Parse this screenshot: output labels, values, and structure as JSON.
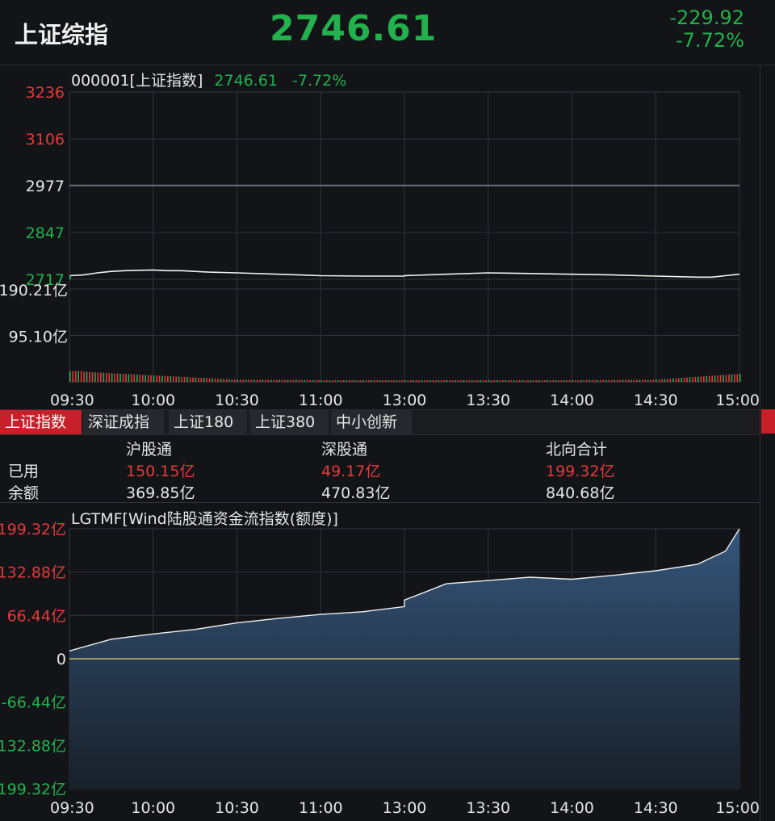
{
  "header": {
    "name": "上证综指",
    "price": "2746.61",
    "change": "-229.92",
    "change_pct": "-7.72%"
  },
  "colors": {
    "up": "#e33a3a",
    "down": "#22b14c",
    "neutral": "#e6e6e6",
    "active_tab": "#c8202a",
    "zero_line": "#e8d36a",
    "flow_fill": "#2f4a66"
  },
  "price_chart": {
    "title_code": "000001[上证指数]",
    "title_price": "2746.61",
    "title_pct": "-7.72%"
  },
  "tabs": [
    "上证指数",
    "深证成指",
    "上证180",
    "上证380",
    "中小创新"
  ],
  "flow_table": {
    "columns": [
      "沪股通",
      "深股通",
      "北向合计"
    ],
    "rows": [
      {
        "label": "已用",
        "values": [
          "150.15亿",
          "49.17亿",
          "199.32亿"
        ]
      },
      {
        "label": "余额",
        "values": [
          "369.85亿",
          "470.83亿",
          "840.68亿"
        ]
      }
    ]
  },
  "flow_chart": {
    "title": "LGTMF[Wind陆股通资金流指数(额度)]"
  },
  "chart_data": [
    {
      "type": "line",
      "title": "000001[上证指数]",
      "x": [
        "09:30",
        "09:35",
        "09:40",
        "09:45",
        "09:50",
        "09:55",
        "10:00",
        "10:05",
        "10:10",
        "10:15",
        "10:20",
        "10:30",
        "10:45",
        "11:00",
        "11:15",
        "11:30",
        "13:00",
        "13:15",
        "13:30",
        "13:45",
        "14:00",
        "14:15",
        "14:30",
        "14:45",
        "14:50",
        "14:55",
        "15:00"
      ],
      "series": [
        {
          "values": [
            2727,
            2729,
            2735,
            2739,
            2741,
            2742,
            2743,
            2741,
            2741,
            2739,
            2737,
            2735,
            2731,
            2727,
            2726,
            2726,
            2727,
            2731,
            2735,
            2733,
            2731,
            2729,
            2726,
            2723,
            2723,
            2727,
            2731
          ]
        }
      ],
      "xticks": [
        "09:30",
        "10:00",
        "10:30",
        "11:00",
        "13:00",
        "13:30",
        "14:00",
        "14:30",
        "15:00"
      ],
      "yticks": [
        "3236",
        "3106",
        "2977",
        "2847",
        "2717"
      ],
      "ylim": [
        2717,
        3236
      ],
      "reference": 2977
    },
    {
      "type": "bar",
      "x": [
        "09:30",
        "10:00",
        "10:30",
        "11:00",
        "13:00",
        "13:30",
        "14:00",
        "14:30",
        "15:00"
      ],
      "series": [
        {
          "values": [
            20,
            12,
            4,
            3,
            3,
            3,
            3,
            4,
            15
          ]
        }
      ],
      "yticks": [
        "190.21亿",
        "95.10亿"
      ],
      "ylim": [
        0,
        190.21
      ]
    },
    {
      "type": "area",
      "title": "LGTMF[Wind陆股通资金流指数(额度)]",
      "x": [
        "09:30",
        "09:45",
        "10:00",
        "10:15",
        "10:30",
        "10:45",
        "11:00",
        "11:15",
        "11:30",
        "13:00",
        "13:15",
        "13:30",
        "13:45",
        "14:00",
        "14:15",
        "14:30",
        "14:45",
        "14:50",
        "14:55",
        "15:00"
      ],
      "series": [
        {
          "values": [
            12,
            30,
            38,
            45,
            55,
            62,
            68,
            72,
            80,
            90,
            115,
            120,
            125,
            122,
            128,
            135,
            145,
            155,
            165,
            199.32
          ]
        }
      ],
      "xticks": [
        "09:30",
        "10:00",
        "10:30",
        "11:00",
        "13:00",
        "13:30",
        "14:00",
        "14:30",
        "15:00"
      ],
      "yticks": [
        "199.32亿",
        "132.88亿",
        "66.44亿",
        "0",
        "-66.44亿",
        "132.88亿",
        "199.32亿"
      ],
      "ylim": [
        -199.32,
        199.32
      ]
    }
  ]
}
